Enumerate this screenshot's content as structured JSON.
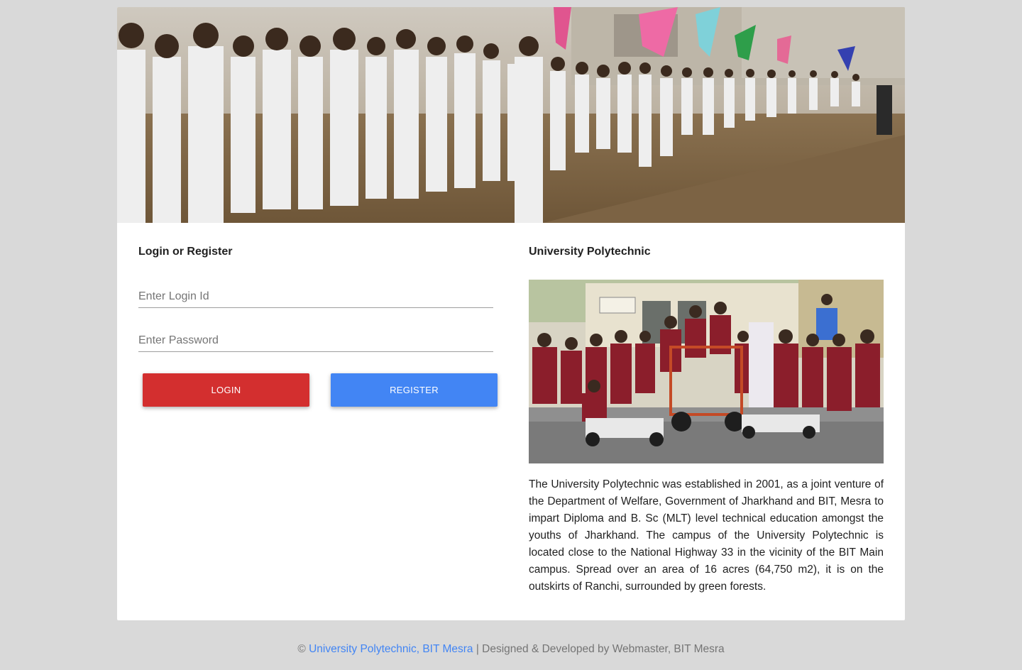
{
  "login": {
    "title": "Login or Register",
    "login_id_placeholder": "Enter Login Id",
    "password_placeholder": "Enter Password",
    "login_button": "LOGIN",
    "register_button": "REGISTER"
  },
  "about": {
    "title": "University Polytechnic",
    "description": "The University Polytechnic was established in 2001, as a joint venture of the Department of Welfare, Government of Jharkhand and BIT, Mesra to impart Diploma and B. Sc (MLT) level technical education amongst the youths of Jharkhand. The campus of the University Polytechnic is located close to the National Highway 33 in the vicinity of the BIT Main campus. Spread over an area of 16 acres (64,750 m2), it is on the outskirts of Ranchi, surrounded by green forests."
  },
  "footer": {
    "copyright_symbol": "©",
    "link_text": "University Polytechnic, BIT Mesra",
    "credit": "| Designed & Developed by Webmaster, BIT Mesra"
  },
  "colors": {
    "page_bg": "#d9d9d9",
    "login_button": "#d32f2f",
    "register_button": "#4285f4",
    "link": "#4285f4"
  }
}
